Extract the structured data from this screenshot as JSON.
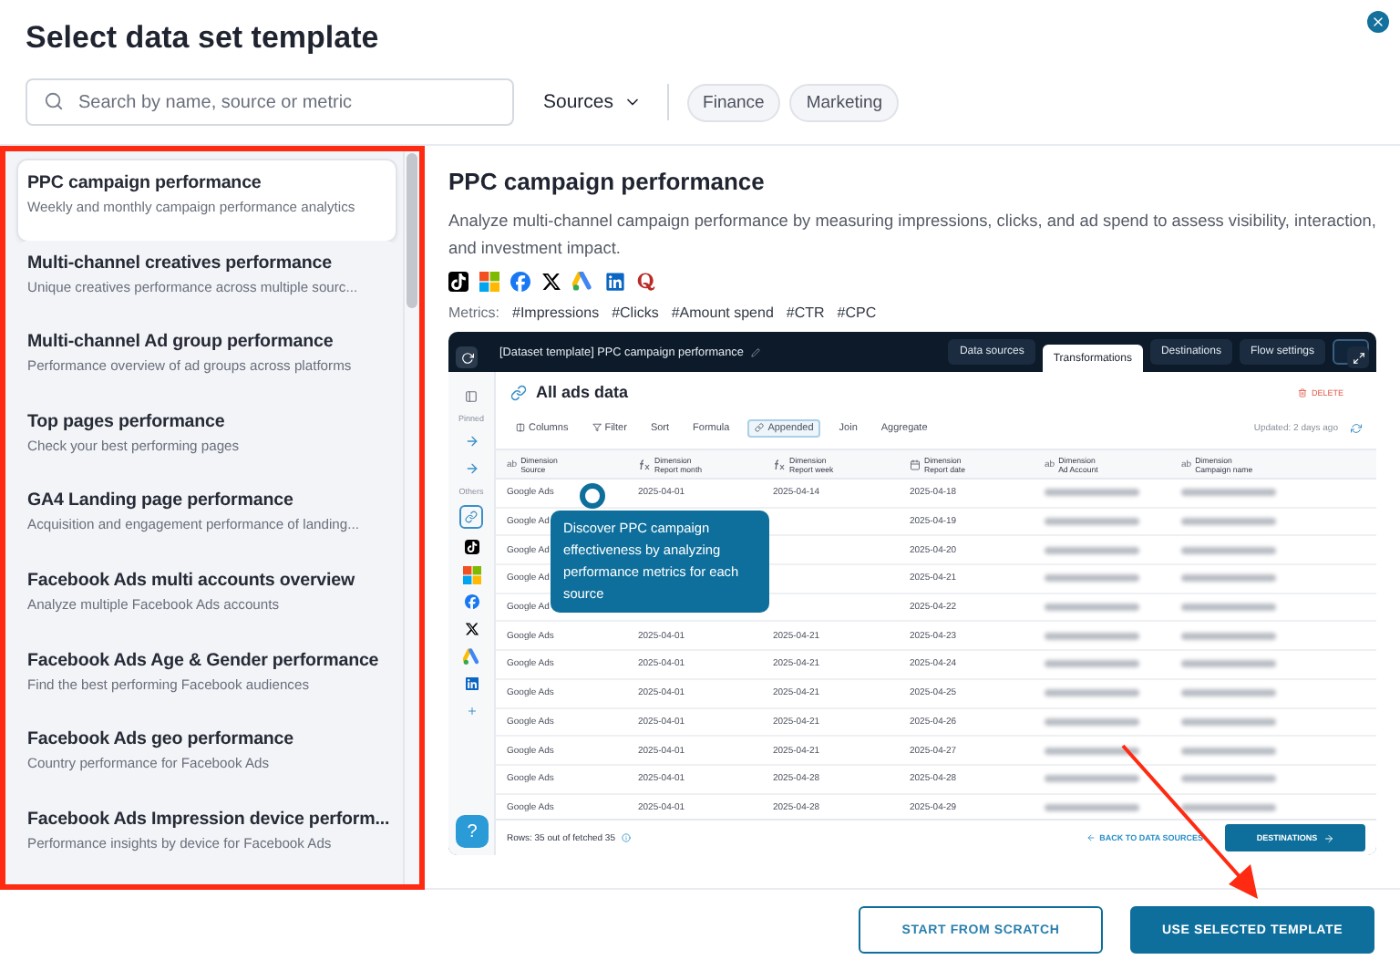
{
  "dialog": {
    "title": "Select data set template"
  },
  "search": {
    "placeholder": "Search by name, source or metric"
  },
  "filters": {
    "dropdown": "Sources",
    "chips": [
      {
        "label": "Finance",
        "selected": false
      },
      {
        "label": "Marketing",
        "selected": false
      }
    ]
  },
  "templates": [
    {
      "title": "PPC campaign performance",
      "description": "Weekly and monthly campaign performance analytics",
      "selected": true
    },
    {
      "title": "Multi-channel creatives performance",
      "description": "Unique creatives performance across multiple sourc...",
      "selected": false
    },
    {
      "title": "Multi-channel Ad group performance",
      "description": "Performance overview of ad groups across platforms",
      "selected": false
    },
    {
      "title": "Top pages performance",
      "description": "Check your best performing pages",
      "selected": false
    },
    {
      "title": "GA4 Landing page performance",
      "description": "Acquisition and engagement performance of landing...",
      "selected": false
    },
    {
      "title": "Facebook Ads multi accounts overview",
      "description": "Analyze multiple Facebook Ads accounts",
      "selected": false
    },
    {
      "title": "Facebook Ads Age & Gender performance",
      "description": "Find the best performing Facebook audiences",
      "selected": false
    },
    {
      "title": "Facebook Ads geo performance",
      "description": "Country performance for Facebook Ads",
      "selected": false
    },
    {
      "title": "Facebook Ads Impression device perform...",
      "description": "Performance insights by device for Facebook Ads",
      "selected": false
    }
  ],
  "detail": {
    "title": "PPC campaign performance",
    "description": "Analyze multi-channel campaign performance by measuring impressions, clicks, and ad spend to assess visibility, interaction, and investment impact.",
    "metrics_label": "Metrics:",
    "metrics": [
      "#Impressions",
      "#Clicks",
      "#Amount spend",
      "#CTR",
      "#CPC"
    ]
  },
  "preview": {
    "window_title": "[Dataset template] PPC campaign performance",
    "tabs": [
      {
        "label": "Data sources",
        "selected": false
      },
      {
        "label": "Transformations",
        "selected": true
      },
      {
        "label": "Destinations",
        "selected": false
      },
      {
        "label": "Flow settings",
        "selected": false
      }
    ],
    "rail": {
      "pinned": "Pinned",
      "others": "Others"
    },
    "table_title": "All ads data",
    "delete": "DELETE",
    "tools": [
      {
        "label": "Columns",
        "selected": false
      },
      {
        "label": "Filter",
        "selected": false
      },
      {
        "label": "Sort",
        "selected": false
      },
      {
        "label": "Formula",
        "selected": false
      },
      {
        "label": "Appended",
        "selected": true
      },
      {
        "label": "Join",
        "selected": false
      },
      {
        "label": "Aggregate",
        "selected": false
      }
    ],
    "updated": "Updated: 2 days ago",
    "columns": [
      {
        "kind": "text",
        "prefix": "ab",
        "category": "Dimension",
        "name": "Source"
      },
      {
        "kind": "formula",
        "category": "Dimension",
        "name": "Report month"
      },
      {
        "kind": "formula",
        "category": "Dimension",
        "name": "Report week"
      },
      {
        "kind": "date",
        "category": "Dimension",
        "name": "Report date"
      },
      {
        "kind": "text",
        "prefix": "ab",
        "category": "Dimension",
        "name": "Ad Account"
      },
      {
        "kind": "text",
        "prefix": "ab",
        "category": "Dimension",
        "name": "Campaign name"
      }
    ],
    "rows": [
      {
        "source": "Google Ads",
        "month": "2025-04-01",
        "week": "2025-04-14",
        "date": "2025-04-18"
      },
      {
        "source": "Google Ad",
        "date": "2025-04-19"
      },
      {
        "source": "Google Ad",
        "date": "2025-04-20"
      },
      {
        "source": "Google Ad",
        "date": "2025-04-21"
      },
      {
        "source": "Google Ad",
        "date": "2025-04-22"
      },
      {
        "source": "Google Ads",
        "month": "2025-04-01",
        "week": "2025-04-21",
        "date": "2025-04-23"
      },
      {
        "source": "Google Ads",
        "month": "2025-04-01",
        "week": "2025-04-21",
        "date": "2025-04-24"
      },
      {
        "source": "Google Ads",
        "month": "2025-04-01",
        "week": "2025-04-21",
        "date": "2025-04-25"
      },
      {
        "source": "Google Ads",
        "month": "2025-04-01",
        "week": "2025-04-21",
        "date": "2025-04-26"
      },
      {
        "source": "Google Ads",
        "month": "2025-04-01",
        "week": "2025-04-21",
        "date": "2025-04-27"
      },
      {
        "source": "Google Ads",
        "month": "2025-04-01",
        "week": "2025-04-28",
        "date": "2025-04-28"
      },
      {
        "source": "Google Ads",
        "month": "2025-04-01",
        "week": "2025-04-28",
        "date": "2025-04-29"
      }
    ],
    "tooltip": "Discover PPC campaign effectiveness by analyzing performance metrics for each source",
    "help": "?",
    "rows_count": "Rows: 35 out of fetched 35",
    "back": "BACK TO DATA SOURCES",
    "next": "DESTINATIONS"
  },
  "footer": {
    "buttons": [
      {
        "label": "START FROM SCRATCH",
        "kind": "secondary"
      },
      {
        "label": "USE SELECTED TEMPLATE",
        "kind": "primary"
      }
    ]
  }
}
